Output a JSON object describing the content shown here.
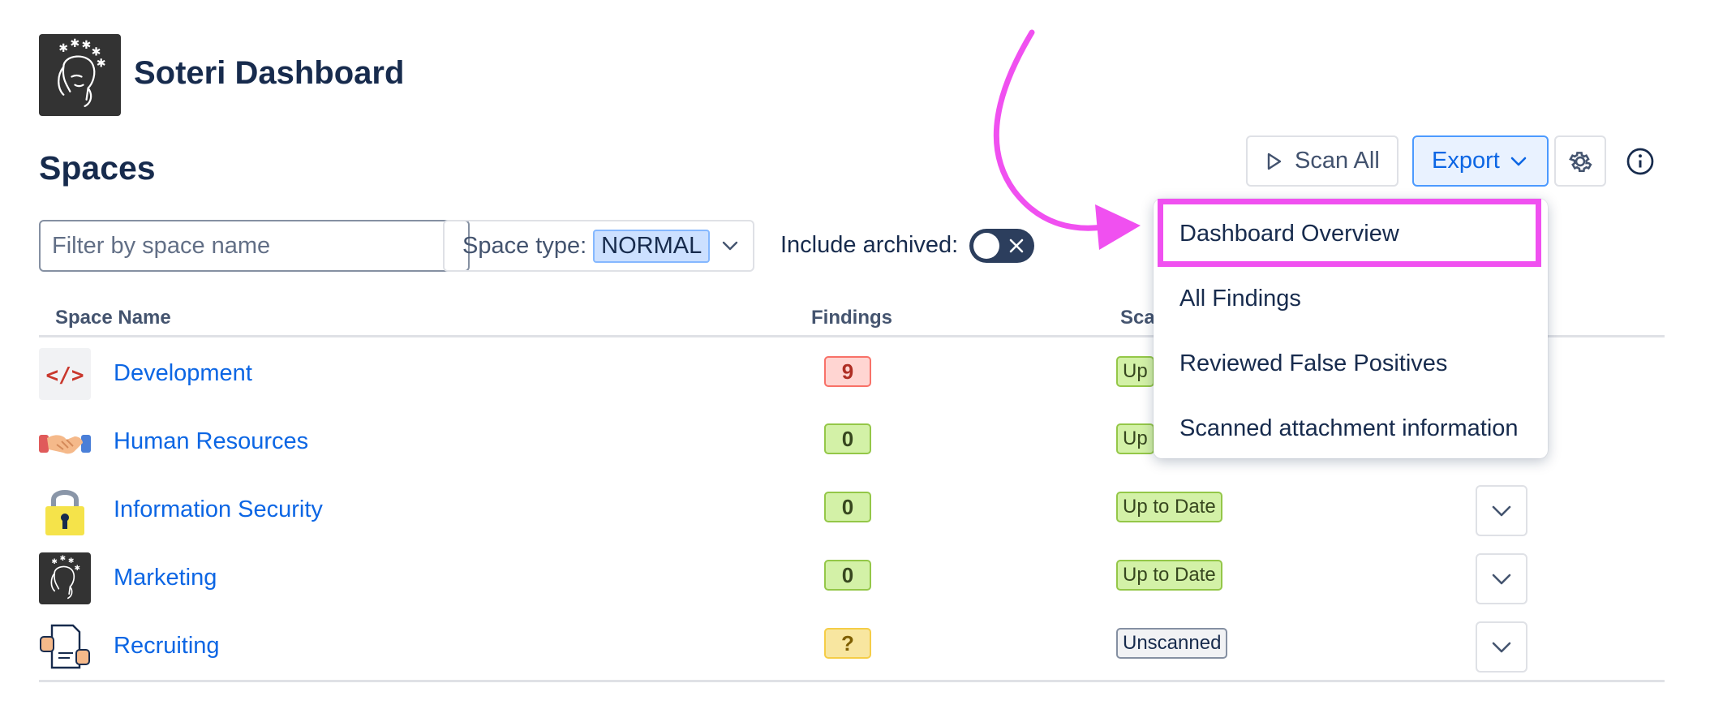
{
  "app": {
    "title": "Soteri Dashboard"
  },
  "page": {
    "heading": "Spaces"
  },
  "toolbar": {
    "scan_all_label": "Scan All",
    "export_label": "Export"
  },
  "filters": {
    "name_placeholder": "Filter by space name",
    "space_type_label": "Space type:",
    "space_type_value": "NORMAL",
    "include_archived_label": "Include archived:",
    "include_archived": false
  },
  "table": {
    "columns": [
      "Space Name",
      "Findings",
      "Sca"
    ],
    "rows": [
      {
        "name": "Development",
        "findings": "9",
        "status": "Up",
        "icon": "code-icon"
      },
      {
        "name": "Human Resources",
        "findings": "0",
        "status": "Up",
        "icon": "handshake-icon"
      },
      {
        "name": "Information Security",
        "findings": "0",
        "status": "Up to Date",
        "icon": "lock-icon"
      },
      {
        "name": "Marketing",
        "findings": "0",
        "status": "Up to Date",
        "icon": "soteri-logo-icon"
      },
      {
        "name": "Recruiting",
        "findings": "?",
        "status": "Unscanned",
        "icon": "document-hands-icon"
      }
    ]
  },
  "export_menu": {
    "items": [
      "Dashboard Overview",
      "All Findings",
      "Reviewed False Positives",
      "Scanned attachment information"
    ]
  },
  "colors": {
    "link": "#0c66e4",
    "annotation": "#f050f0",
    "findings_red": "#ffd5d2",
    "status_green": "#d3f1a7"
  }
}
